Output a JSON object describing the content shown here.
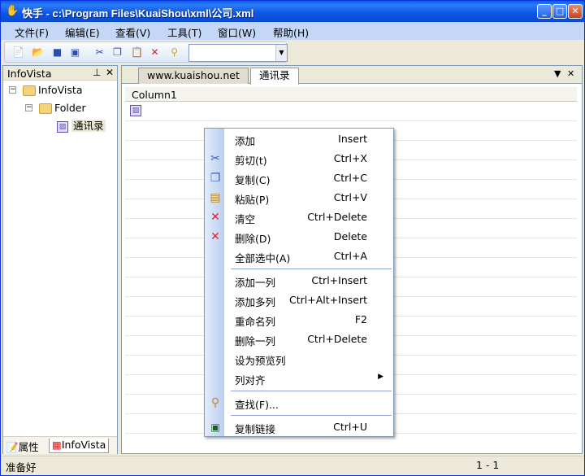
{
  "window": {
    "title": "快手 - c:\\Program Files\\KuaiShou\\xml\\公司.xml"
  },
  "menubar": {
    "items": [
      "文件(F)",
      "编辑(E)",
      "查看(V)",
      "工具(T)",
      "窗口(W)",
      "帮助(H)"
    ]
  },
  "toolbar": {
    "combo_value": ""
  },
  "left_pane": {
    "title": "InfoVista",
    "tree": [
      {
        "label": "InfoVista",
        "expander": "−"
      },
      {
        "label": "Folder",
        "expander": "−"
      },
      {
        "label": "通讯录"
      }
    ],
    "bottom_tabs": [
      "属性",
      "InfoVista"
    ]
  },
  "right_pane": {
    "tabs": [
      "www.kuaishou.net",
      "通讯录"
    ],
    "column_header": "Column1"
  },
  "context_menu": {
    "group1": [
      {
        "label": "添加",
        "shortcut": "Insert",
        "icon": ""
      },
      {
        "label": "剪切(t)",
        "shortcut": "Ctrl+X",
        "icon": "scissors-icon"
      },
      {
        "label": "复制(C)",
        "shortcut": "Ctrl+C",
        "icon": "copy-icon"
      },
      {
        "label": "粘贴(P)",
        "shortcut": "Ctrl+V",
        "icon": "paste-icon"
      },
      {
        "label": "清空",
        "shortcut": "Ctrl+Delete",
        "icon": "red-x-icon"
      },
      {
        "label": "删除(D)",
        "shortcut": "Delete",
        "icon": "red-x-icon"
      },
      {
        "label": "全部选中(A)",
        "shortcut": "Ctrl+A",
        "icon": ""
      }
    ],
    "group2": [
      {
        "label": "添加一列",
        "shortcut": "Ctrl+Insert"
      },
      {
        "label": "添加多列",
        "shortcut": "Ctrl+Alt+Insert"
      },
      {
        "label": "重命名列",
        "shortcut": "F2"
      },
      {
        "label": "删除一列",
        "shortcut": "Ctrl+Delete"
      },
      {
        "label": "设为预览列",
        "shortcut": ""
      },
      {
        "label": "列对齐",
        "shortcut": "",
        "submenu": true
      }
    ],
    "group3": [
      {
        "label": "查找(F)...",
        "shortcut": "",
        "icon": "magnifier-icon"
      }
    ],
    "group4": [
      {
        "label": "复制链接",
        "shortcut": "Ctrl+U",
        "icon": "link-copy-icon"
      }
    ]
  },
  "statusbar": {
    "text": "准备好",
    "position": "1 - 1"
  }
}
